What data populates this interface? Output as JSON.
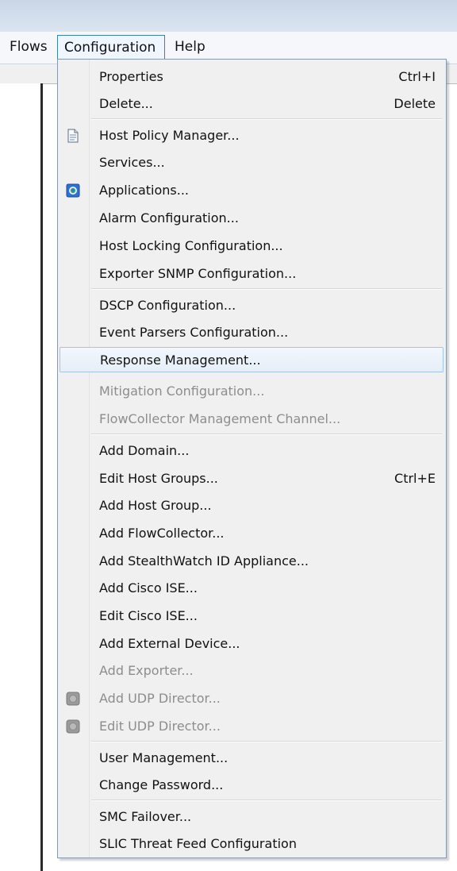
{
  "menubar": {
    "items": [
      {
        "label": "Flows"
      },
      {
        "label": "Configuration"
      },
      {
        "label": "Help"
      }
    ]
  },
  "menu": {
    "items": [
      {
        "label": "Properties",
        "shortcut": "Ctrl+I",
        "enabled": true
      },
      {
        "label": "Delete...",
        "shortcut": "Delete",
        "enabled": true
      },
      {
        "label": "Host Policy Manager...",
        "shortcut": "",
        "enabled": true,
        "icon": "document-icon"
      },
      {
        "label": "Services...",
        "shortcut": "",
        "enabled": true
      },
      {
        "label": "Applications...",
        "shortcut": "",
        "enabled": true,
        "icon": "globe-icon"
      },
      {
        "label": "Alarm Configuration...",
        "shortcut": "",
        "enabled": true
      },
      {
        "label": "Host Locking Configuration...",
        "shortcut": "",
        "enabled": true
      },
      {
        "label": "Exporter SNMP Configuration...",
        "shortcut": "",
        "enabled": true
      },
      {
        "label": "DSCP Configuration...",
        "shortcut": "",
        "enabled": true
      },
      {
        "label": "Event Parsers Configuration...",
        "shortcut": "",
        "enabled": true
      },
      {
        "label": "Response Management...",
        "shortcut": "",
        "enabled": true,
        "highlighted": true
      },
      {
        "label": "Mitigation Configuration...",
        "shortcut": "",
        "enabled": false
      },
      {
        "label": "FlowCollector Management Channel...",
        "shortcut": "",
        "enabled": false
      },
      {
        "label": "Add Domain...",
        "shortcut": "",
        "enabled": true
      },
      {
        "label": "Edit Host Groups...",
        "shortcut": "Ctrl+E",
        "enabled": true
      },
      {
        "label": "Add Host Group...",
        "shortcut": "",
        "enabled": true
      },
      {
        "label": "Add FlowCollector...",
        "shortcut": "",
        "enabled": true
      },
      {
        "label": "Add StealthWatch ID Appliance...",
        "shortcut": "",
        "enabled": true
      },
      {
        "label": "Add Cisco ISE...",
        "shortcut": "",
        "enabled": true
      },
      {
        "label": "Edit Cisco ISE...",
        "shortcut": "",
        "enabled": true
      },
      {
        "label": "Add External Device...",
        "shortcut": "",
        "enabled": true
      },
      {
        "label": "Add Exporter...",
        "shortcut": "",
        "enabled": false
      },
      {
        "label": "Add UDP Director...",
        "shortcut": "",
        "enabled": false,
        "icon": "device-icon"
      },
      {
        "label": "Edit UDP Director...",
        "shortcut": "",
        "enabled": false,
        "icon": "device-icon"
      },
      {
        "label": "User Management...",
        "shortcut": "",
        "enabled": true
      },
      {
        "label": "Change Password...",
        "shortcut": "",
        "enabled": true
      },
      {
        "label": "SMC Failover...",
        "shortcut": "",
        "enabled": true
      },
      {
        "label": "SLIC Threat Feed Configuration",
        "shortcut": "",
        "enabled": true
      }
    ]
  },
  "colors": {
    "highlight_border": "#a8c4e4",
    "active_menu_border": "#3c7fb1",
    "disabled_text": "#8d8d8d"
  }
}
